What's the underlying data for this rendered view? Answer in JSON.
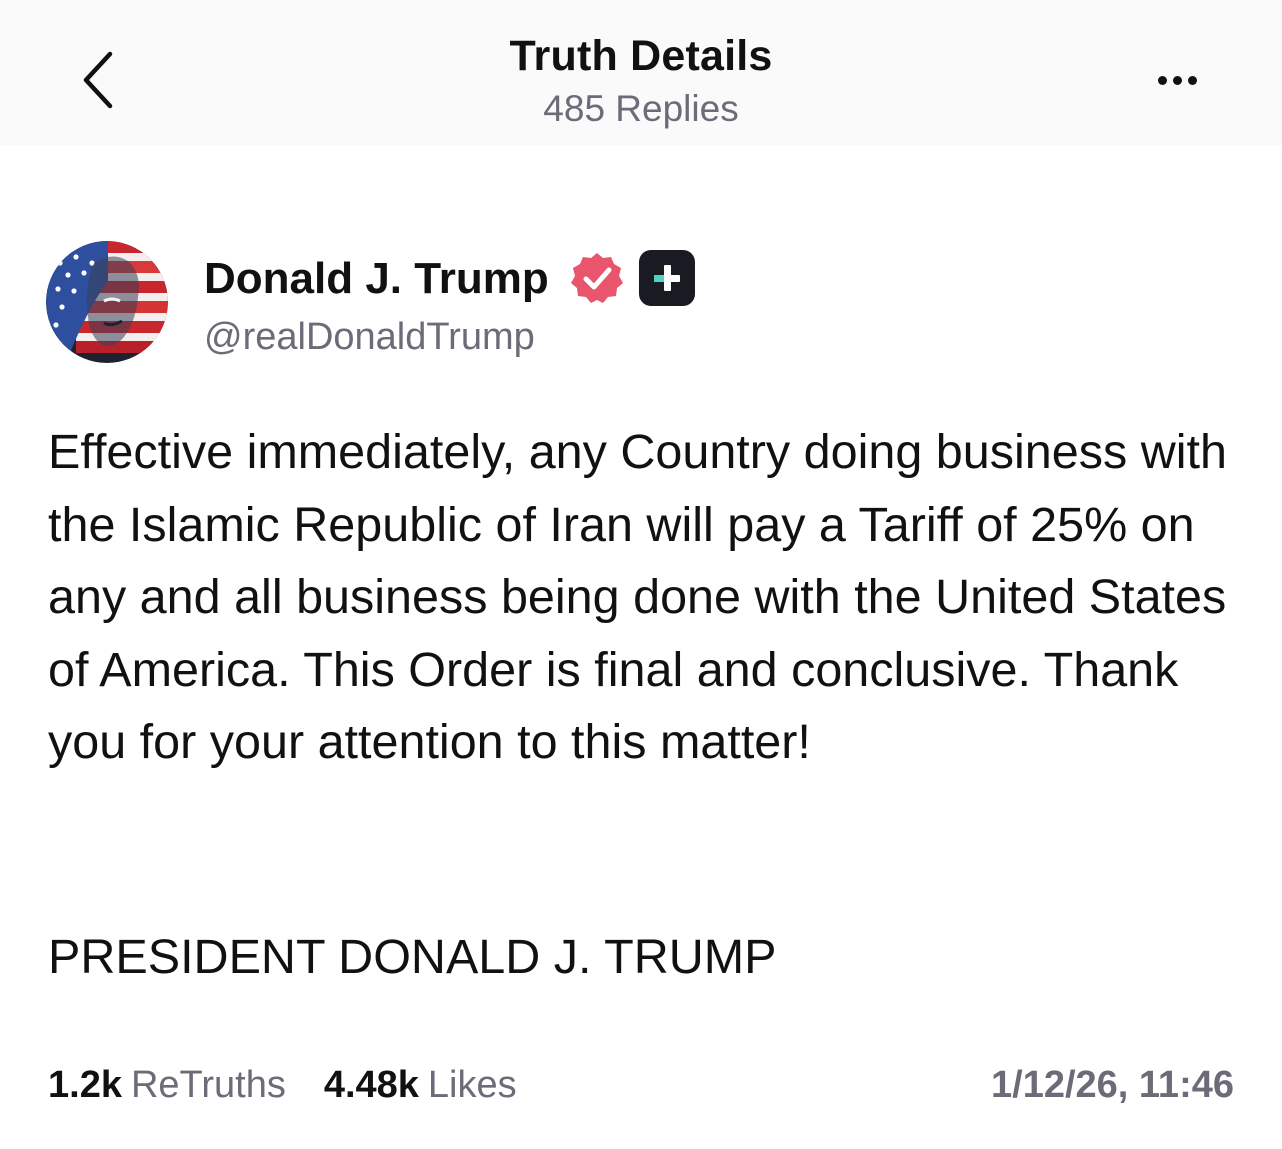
{
  "header": {
    "title": "Truth Details",
    "replies": "485 Replies",
    "back_icon": "chevron-left-icon",
    "more_icon": "more-horizontal-icon"
  },
  "post": {
    "author": {
      "name": "Donald J. Trump",
      "handle": "@realDonaldTrump",
      "verified_icon": "verified-badge-icon",
      "plus_icon": "plus-badge-icon"
    },
    "body": "Effective immediately, any Country doing business with the Islamic Republic of Iran will pay a Tariff of 25% on any and all business being done with the United States of America. This Order is final and conclusive. Thank you for your attention to this matter!",
    "signature": "PRESIDENT DONALD J. TRUMP",
    "stats": {
      "retruths_count": "1.2k",
      "retruths_label": "ReTruths",
      "likes_count": "4.48k",
      "likes_label": "Likes"
    },
    "timestamp": "1/12/26, 11:46"
  },
  "colors": {
    "text": "#111114",
    "muted": "#6c6b78",
    "verified": "#e8556d",
    "badge_bg": "#1a1a22",
    "badge_accent": "#4fd1c5"
  }
}
